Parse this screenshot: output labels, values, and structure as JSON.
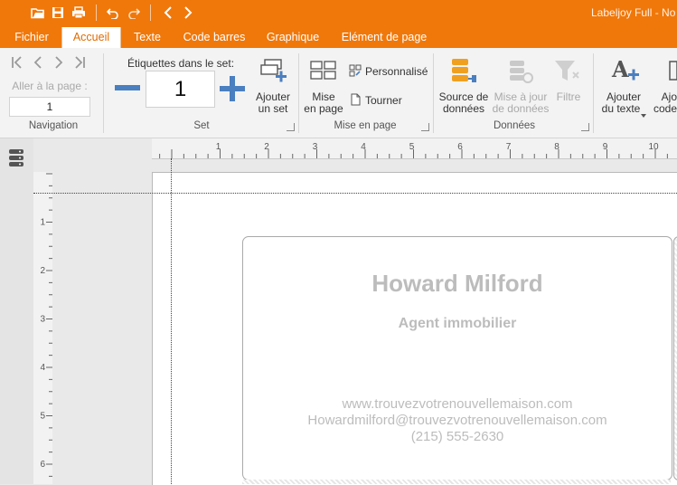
{
  "window": {
    "title": "Labeljoy Full - No"
  },
  "tabs": [
    {
      "label": "Fichier"
    },
    {
      "label": "Accueil"
    },
    {
      "label": "Texte"
    },
    {
      "label": "Code barres"
    },
    {
      "label": "Graphique"
    },
    {
      "label": "Elément de page"
    }
  ],
  "ribbon": {
    "navigation": {
      "goto_label": "Aller à la page :",
      "page_value": "1",
      "group_label": "Navigation"
    },
    "set": {
      "title": "Étiquettes dans le set:",
      "count": "1",
      "add_label_line1": "Ajouter",
      "add_label_line2": "un set",
      "group_label": "Set"
    },
    "layout": {
      "mise_line1": "Mise",
      "mise_line2": "en page",
      "personnalise": "Personnalisé",
      "tourner": "Tourner",
      "group_label": "Mise en page"
    },
    "data": {
      "source_line1": "Source de",
      "source_line2": "données",
      "update_line1": "Mise à jour",
      "update_line2": "de données",
      "filter": "Filtre",
      "group_label": "Données"
    },
    "insert": {
      "add_text_line1": "Ajouter",
      "add_text_line2": "du texte",
      "add_code_line1": "Ajo",
      "add_code_line2": "code"
    }
  },
  "ruler": {
    "h": [
      "1",
      "2",
      "3",
      "4",
      "5",
      "6",
      "7",
      "8",
      "9",
      "10"
    ],
    "v": [
      "1",
      "2",
      "3",
      "4",
      "5",
      "6"
    ]
  },
  "label": {
    "name": "Howard Milford",
    "role": "Agent immobilier",
    "website": "www.trouvezvotrenouvellemaison.com",
    "email": "Howardmilford@trouvezvotrenouvellemaison.com",
    "phone": "(215) 555-2630"
  },
  "colors": {
    "accent": "#f0780a",
    "icon_blue": "#4a7fc0",
    "label_text": "#bcbcbc"
  }
}
